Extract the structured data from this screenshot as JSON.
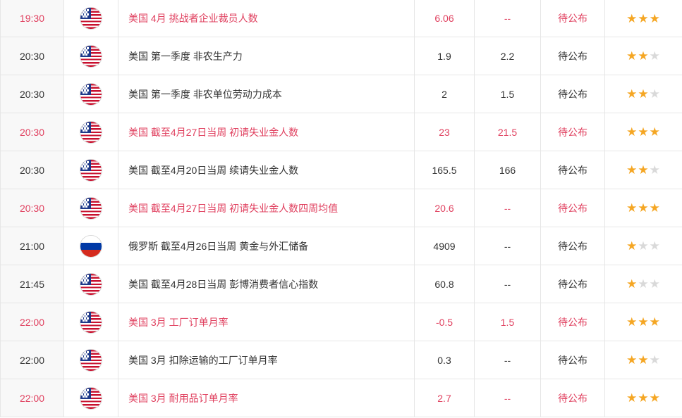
{
  "rows": [
    {
      "time": "19:30",
      "flag": "us-flag",
      "event": "美国 4月 挑战者企业裁员人数",
      "previous": "6.06",
      "forecast": "--",
      "actual": "待公布",
      "stars": 3,
      "highlight": true
    },
    {
      "time": "20:30",
      "flag": "us-flag",
      "event": "美国 第一季度 非农生产力",
      "previous": "1.9",
      "forecast": "2.2",
      "actual": "待公布",
      "stars": 2,
      "highlight": false
    },
    {
      "time": "20:30",
      "flag": "us-flag",
      "event": "美国 第一季度 非农单位劳动力成本",
      "previous": "2",
      "forecast": "1.5",
      "actual": "待公布",
      "stars": 2,
      "highlight": false
    },
    {
      "time": "20:30",
      "flag": "us-flag",
      "event": "美国 截至4月27日当周 初请失业金人数",
      "previous": "23",
      "forecast": "21.5",
      "actual": "待公布",
      "stars": 3,
      "highlight": true
    },
    {
      "time": "20:30",
      "flag": "us-flag",
      "event": "美国 截至4月20日当周 续请失业金人数",
      "previous": "165.5",
      "forecast": "166",
      "actual": "待公布",
      "stars": 2,
      "highlight": false
    },
    {
      "time": "20:30",
      "flag": "us-flag",
      "event": "美国 截至4月27日当周 初请失业金人数四周均值",
      "previous": "20.6",
      "forecast": "--",
      "actual": "待公布",
      "stars": 3,
      "highlight": true
    },
    {
      "time": "21:00",
      "flag": "ru-flag",
      "event": "俄罗斯 截至4月26日当周 黄金与外汇储备",
      "previous": "4909",
      "forecast": "--",
      "actual": "待公布",
      "stars": 1,
      "highlight": false
    },
    {
      "time": "21:45",
      "flag": "us-flag",
      "event": "美国 截至4月28日当周 彭博消费者信心指数",
      "previous": "60.8",
      "forecast": "--",
      "actual": "待公布",
      "stars": 1,
      "highlight": false
    },
    {
      "time": "22:00",
      "flag": "us-flag",
      "event": "美国 3月 工厂订单月率",
      "previous": "-0.5",
      "forecast": "1.5",
      "actual": "待公布",
      "stars": 3,
      "highlight": true
    },
    {
      "time": "22:00",
      "flag": "us-flag",
      "event": "美国 3月 扣除运输的工厂订单月率",
      "previous": "0.3",
      "forecast": "--",
      "actual": "待公布",
      "stars": 2,
      "highlight": false
    },
    {
      "time": "22:00",
      "flag": "us-flag",
      "event": "美国 3月 耐用品订单月率",
      "previous": "2.7",
      "forecast": "--",
      "actual": "待公布",
      "stars": 3,
      "highlight": true
    }
  ],
  "colors": {
    "highlight_text": "#e0405f",
    "normal_text": "#333333",
    "star_on": "#f5a623",
    "star_off": "#d9d9d9"
  }
}
